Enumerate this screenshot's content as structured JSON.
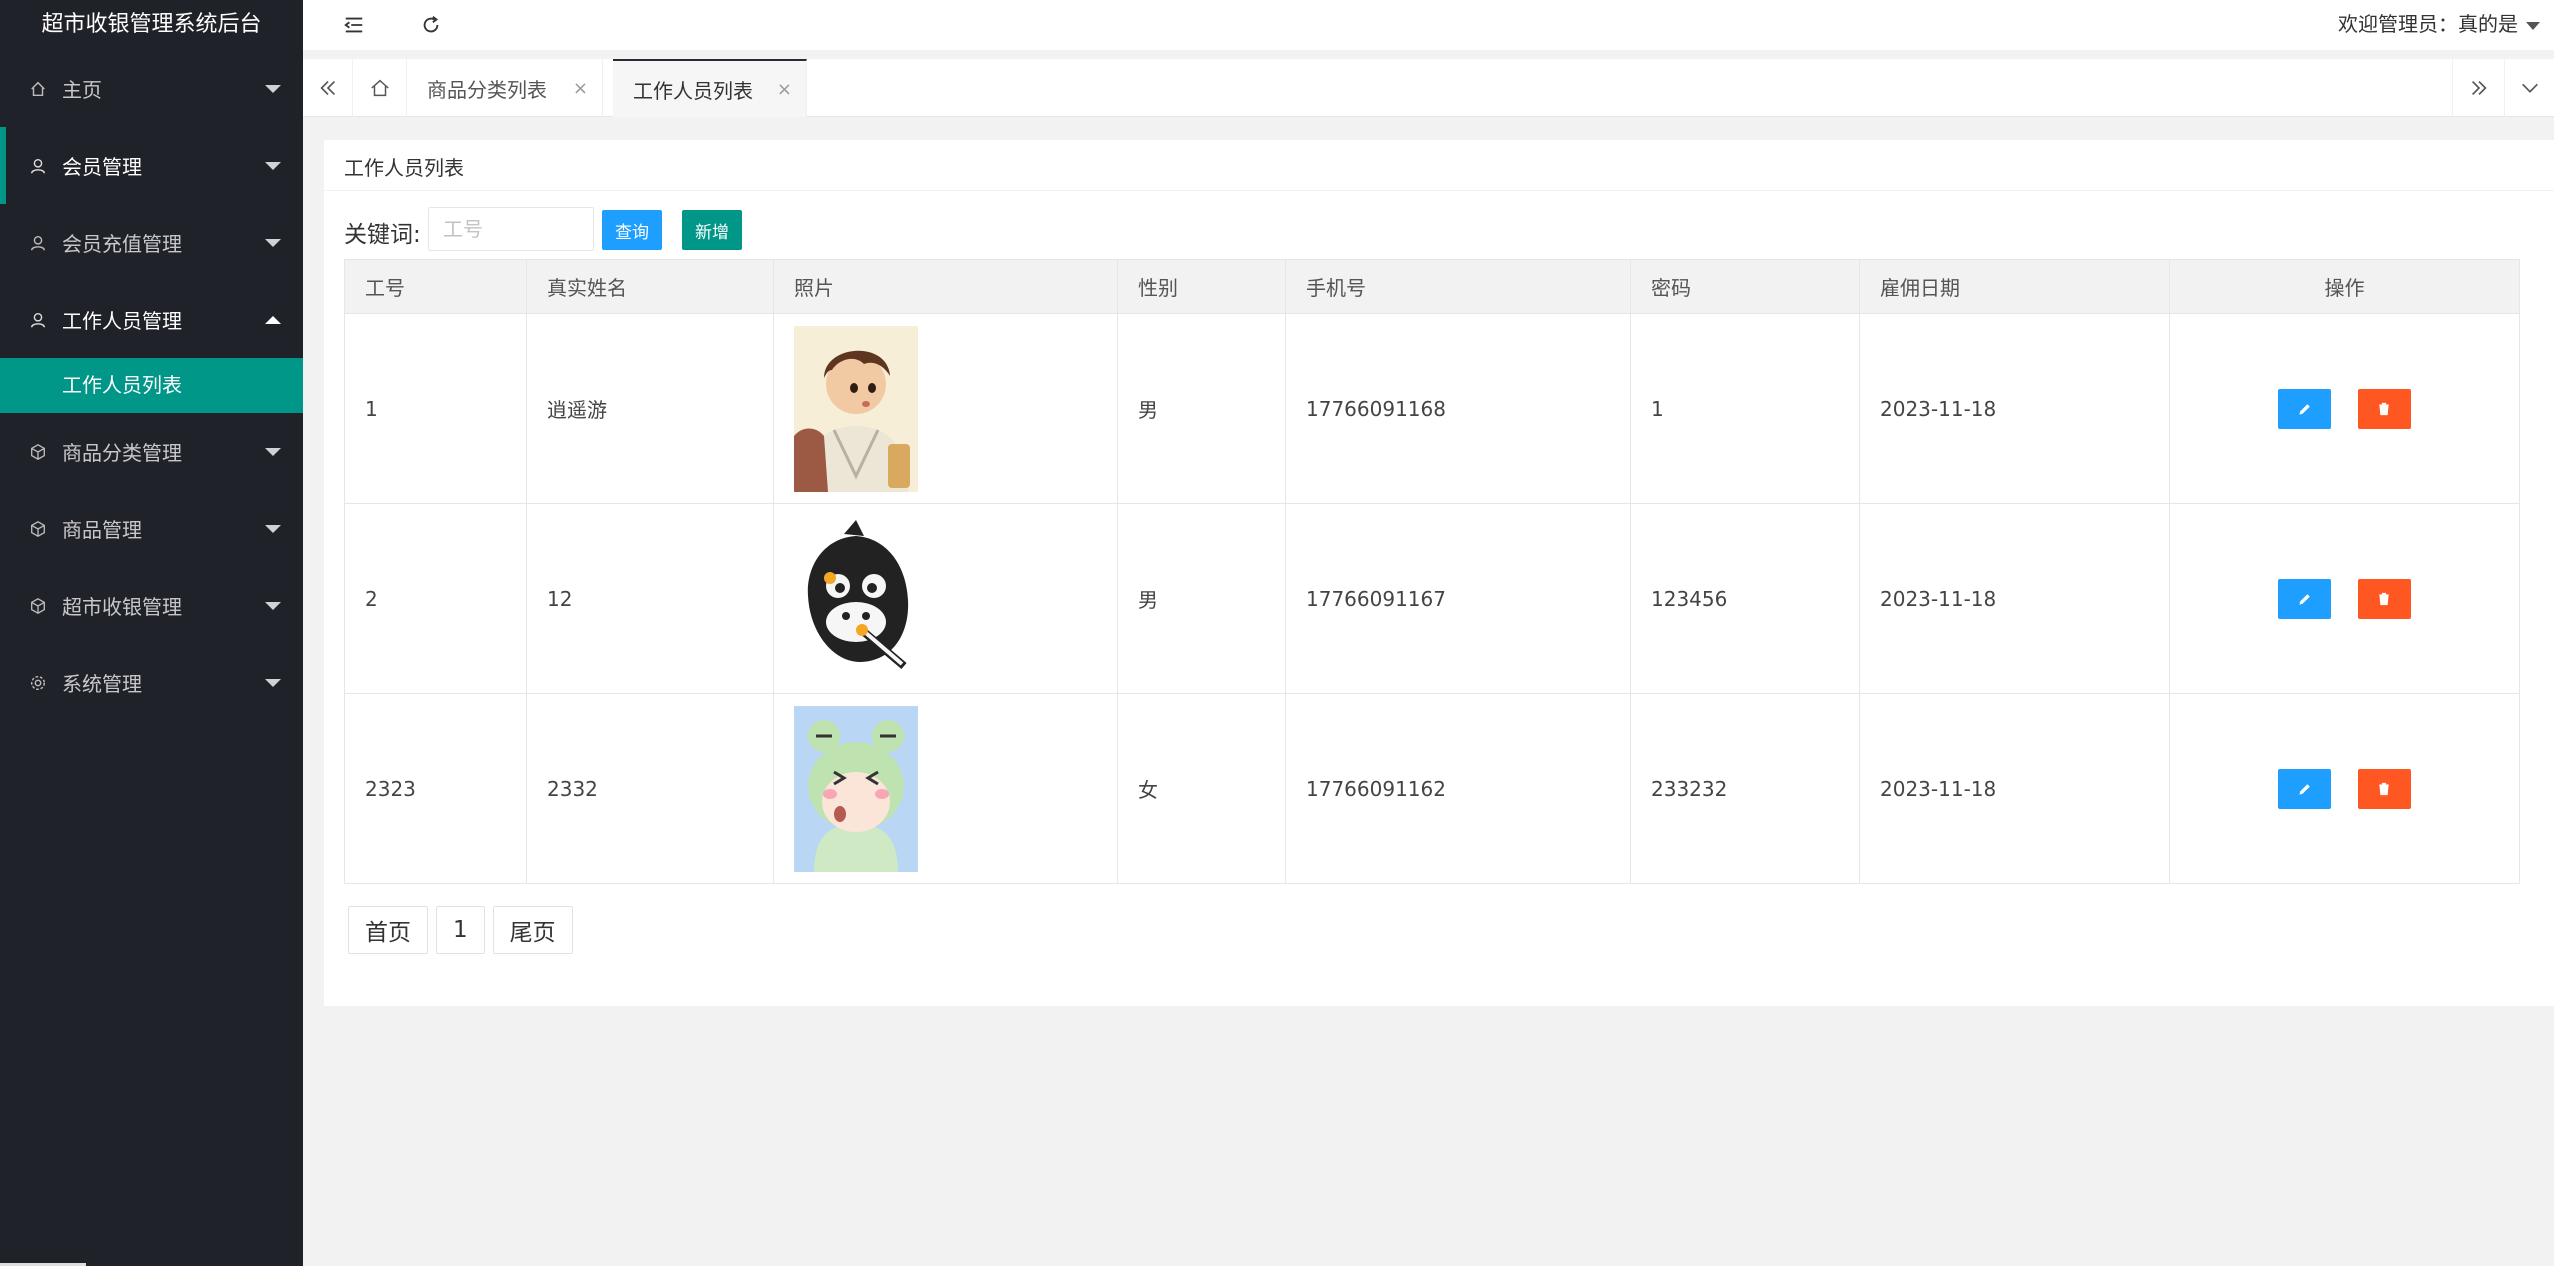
{
  "app": {
    "title": "超市收银管理系统后台"
  },
  "header": {
    "welcome": "欢迎管理员：真的是"
  },
  "sidebar": {
    "items": [
      {
        "label": "主页",
        "icon": "home-icon"
      },
      {
        "label": "会员管理",
        "icon": "user-icon"
      },
      {
        "label": "会员充值管理",
        "icon": "user-icon"
      },
      {
        "label": "工作人员管理",
        "icon": "user-icon"
      },
      {
        "label": "商品分类管理",
        "icon": "cube-icon"
      },
      {
        "label": "商品管理",
        "icon": "cube-icon"
      },
      {
        "label": "超市收银管理",
        "icon": "cube-icon"
      },
      {
        "label": "系统管理",
        "icon": "gear-icon"
      }
    ],
    "sub_item": "工作人员列表"
  },
  "tabs": [
    {
      "label": "商品分类列表",
      "close": "×"
    },
    {
      "label": "工作人员列表",
      "close": "×"
    }
  ],
  "card": {
    "title": "工作人员列表"
  },
  "search": {
    "label": "关键词:",
    "placeholder": "工号",
    "query_label": "查询",
    "add_label": "新增"
  },
  "table": {
    "headers": [
      "工号",
      "真实姓名",
      "照片",
      "性别",
      "手机号",
      "密码",
      "雇佣日期",
      "操作"
    ],
    "rows": [
      {
        "id": "1",
        "name": "逍遥游",
        "photo": "boy-avatar",
        "gender": "男",
        "phone": "17766091168",
        "password": "1",
        "date": "2023-11-18"
      },
      {
        "id": "2",
        "name": "12",
        "photo": "gorilla-avatar",
        "gender": "男",
        "phone": "17766091167",
        "password": "123456",
        "date": "2023-11-18"
      },
      {
        "id": "2323",
        "name": "2332",
        "photo": "frog-avatar",
        "gender": "女",
        "phone": "17766091162",
        "password": "233232",
        "date": "2023-11-18"
      }
    ]
  },
  "pager": {
    "first": "首页",
    "current": "1",
    "last": "尾页"
  },
  "colors": {
    "sidebar_bg": "#20222a",
    "accent": "#009688",
    "blue": "#1e9fff",
    "orange": "#ff5722"
  }
}
